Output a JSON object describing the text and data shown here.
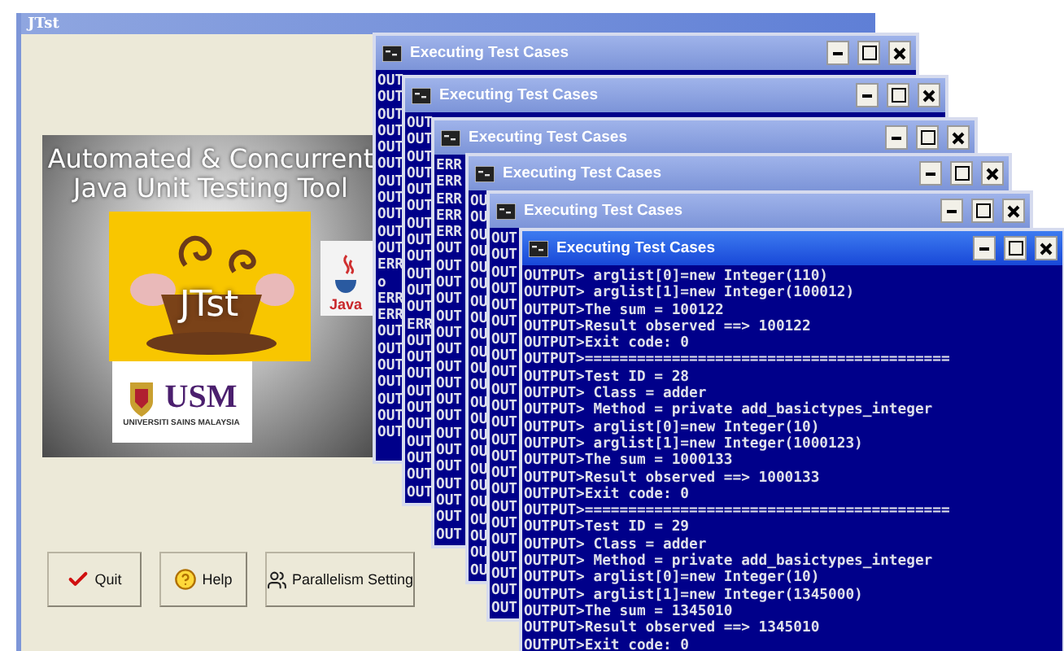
{
  "app": {
    "title": "JTst",
    "heading_lines": [
      "Automated & Concurrent",
      "Java Unit Testing Tool"
    ],
    "cup_label": "JTst",
    "java_label": "Java",
    "usm_mark": "USM",
    "university": "UNIVERSITI SAINS MALAYSIA",
    "buttons": [
      {
        "label": "Quit",
        "kind": "quit"
      },
      {
        "label": "Help",
        "kind": "help"
      },
      {
        "label": "Parallelism Setting",
        "kind": "parallel"
      }
    ]
  },
  "consoles": [
    {
      "title": "Executing Test Cases",
      "active": false,
      "lines": [
        "OUT",
        "OUT",
        "OUT",
        "OUT",
        "OUT",
        "OUT",
        "OUT",
        "OUT",
        "OUT",
        "OUT",
        "OUT",
        "ERR",
        "o",
        "ERR",
        "ERR",
        "OUT",
        "OUT",
        "OUT",
        "OUT",
        "OUT",
        "OUT",
        "OUT"
      ]
    },
    {
      "title": "Executing Test Cases",
      "active": false,
      "lines": [
        "OUT",
        "OUT",
        "OUT",
        "OUT",
        "OUT",
        "OUT",
        "OUT",
        "OUT",
        "OUT",
        "OUT",
        "OUT",
        "OUT",
        "ERR",
        "OUT",
        "OUT",
        "OUT",
        "OUT",
        "OUT",
        "OUT",
        "OUT",
        "OUT",
        "OUT",
        "OUT"
      ]
    },
    {
      "title": "Executing Test Cases",
      "active": false,
      "lines": [
        "ERR",
        "ERR",
        "ERR",
        "ERR",
        "ERR",
        "OUT",
        "OUT",
        "OUT",
        "OUT",
        "OUT",
        "OUT",
        "OUT",
        "OUT",
        "OUT",
        "OUT",
        "OUT",
        "OUT",
        "OUT",
        "OUT",
        "OUT",
        "OUT",
        "OUT",
        "OUT"
      ]
    },
    {
      "title": "Executing Test Cases",
      "active": false,
      "lines": [
        "OU",
        "OU",
        "OU",
        "OU",
        "OU",
        "OU",
        "OU",
        "OU",
        "OU",
        "OU",
        "OU",
        "OU",
        "OU",
        "OU",
        "OU",
        "OU",
        "OU",
        "OU",
        "OU",
        "OU",
        "OU",
        "OU",
        "OU"
      ]
    },
    {
      "title": "Executing Test Cases",
      "active": false,
      "lines": [
        "OUT",
        "OUT",
        "OUT",
        "OUT",
        "OUT",
        "OUT",
        "OUT",
        "OUT",
        "OUT",
        "OUT",
        "OUT",
        "OUT",
        "OUT",
        "OUT",
        "OUT",
        "OUT",
        "OUT",
        "OUT",
        "OUT",
        "OUT",
        "OUT",
        "OUT",
        "OUT"
      ]
    },
    {
      "title": "Executing Test Cases",
      "active": true,
      "lines": [
        "OUTPUT> arglist[0]=new Integer(110)",
        "OUTPUT> arglist[1]=new Integer(100012)",
        "OUTPUT>The sum = 100122",
        "OUTPUT>Result observed ==> 100122",
        "OUTPUT>Exit code: 0",
        "OUTPUT>==========================================",
        "OUTPUT>Test ID = 28",
        "OUTPUT> Class = adder",
        "OUTPUT> Method = private add_basictypes_integer",
        "OUTPUT> arglist[0]=new Integer(10)",
        "OUTPUT> arglist[1]=new Integer(1000123)",
        "OUTPUT>The sum = 1000133",
        "OUTPUT>Result observed ==> 1000133",
        "OUTPUT>Exit code: 0",
        "OUTPUT>==========================================",
        "OUTPUT>Test ID = 29",
        "OUTPUT> Class = adder",
        "OUTPUT> Method = private add_basictypes_integer",
        "OUTPUT> arglist[0]=new Integer(10)",
        "OUTPUT> arglist[1]=new Integer(1345000)",
        "OUTPUT>The sum = 1345010",
        "OUTPUT>Result observed ==> 1345010",
        "OUTPUT>Exit code: 0"
      ]
    }
  ]
}
